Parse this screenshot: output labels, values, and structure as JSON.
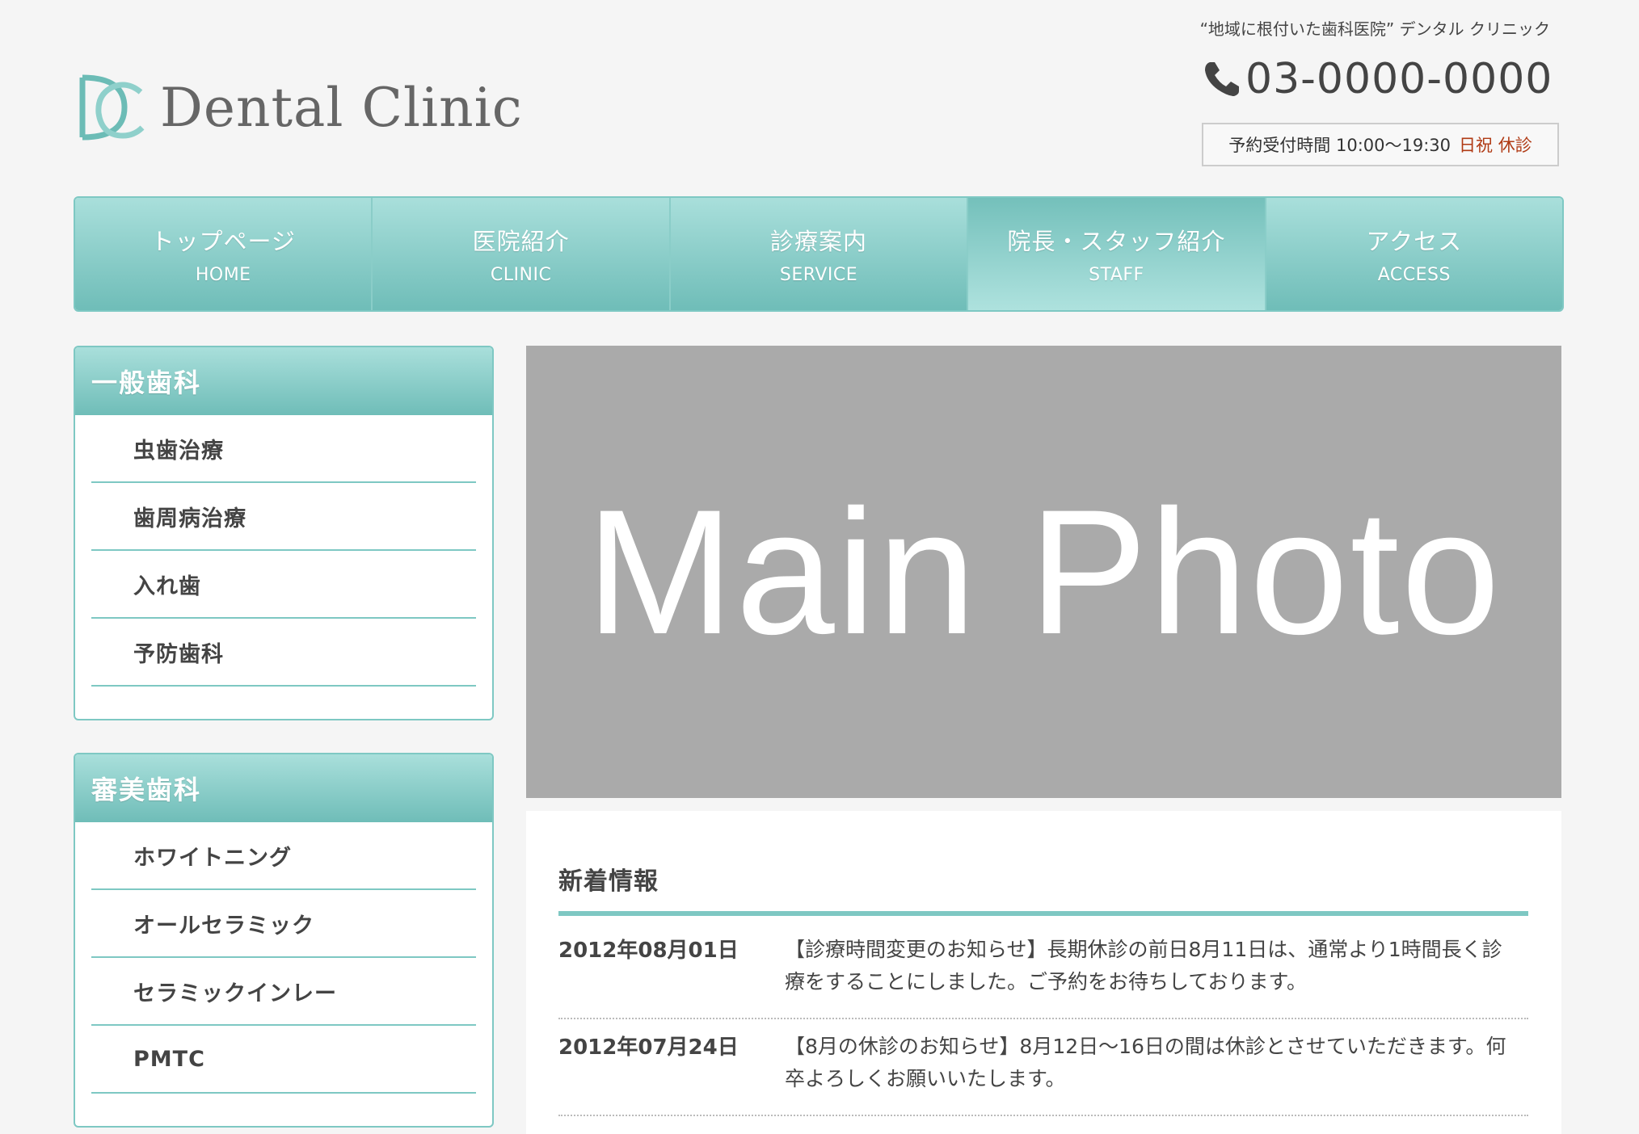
{
  "header": {
    "logo_text": "Dental Clinic",
    "tagline": "“地域に根付いた歯科医院” デンタル クリニック",
    "phone": "03-0000-0000",
    "hours": "予約受付時間 10:00〜19:30",
    "closed": "日祝 休診"
  },
  "nav": [
    {
      "jp": "トップページ",
      "en": "HOME"
    },
    {
      "jp": "医院紹介",
      "en": "CLINIC"
    },
    {
      "jp": "診療案内",
      "en": "SERVICE"
    },
    {
      "jp": "院長・スタッフ紹介",
      "en": "STAFF"
    },
    {
      "jp": "アクセス",
      "en": "ACCESS"
    }
  ],
  "sidebar": {
    "general": {
      "title": "一般歯科",
      "items": [
        "虫歯治療",
        "歯周病治療",
        "入れ歯",
        "予防歯科"
      ]
    },
    "cosmetic": {
      "title": "審美歯科",
      "items": [
        "ホワイトニング",
        "オールセラミック",
        "セラミックインレー",
        "PMTC"
      ]
    }
  },
  "main_photo": {
    "label": "Main Photo"
  },
  "news": {
    "title": "新着情報",
    "items": [
      {
        "date": "2012年08月01日",
        "text": "【診療時間変更のお知らせ】長期休診の前日8月11日は、通常より1時間長く診療をすることにしました。ご予約をお待ちしております。"
      },
      {
        "date": "2012年07月24日",
        "text": "【8月の休診のお知らせ】8月12日〜16日の間は休診とさせていただきます。何卒よろしくお願いいたします。"
      }
    ]
  },
  "colors": {
    "accent": "#7ec8c3",
    "closed": "#b03a14",
    "photo_bg": "#aaaaaa"
  }
}
